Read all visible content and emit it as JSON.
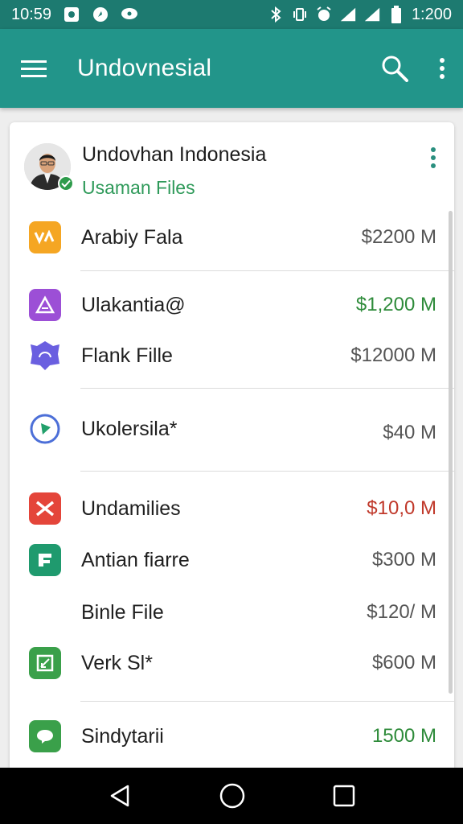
{
  "status_bar": {
    "time_left": "10:59",
    "time_right": "1:200"
  },
  "app_bar": {
    "title": "Undovnesial"
  },
  "header": {
    "name": "Undovhan Indonesia",
    "subtitle": "Usaman Files"
  },
  "rows": [
    {
      "label": "Arabiy Fala",
      "value": "$2200  M",
      "value_color": "#555555",
      "icon": "vox-app-icon",
      "icon_color": "#f5a623"
    },
    {
      "label": "Ulakantia@",
      "value": "$1,200  M",
      "value_color": "#2e8b3a",
      "icon": "triangle-app-icon",
      "icon_color": "#9c4fd6"
    },
    {
      "label": "Flank Fille",
      "value": "$12000  M",
      "value_color": "#555555",
      "icon": "badge-app-icon",
      "icon_color": "#6a5fe0"
    },
    {
      "label": "Ukolersila*",
      "value": "$40 M",
      "value_color": "#555555",
      "icon": "play-circle-icon",
      "icon_color": "#4c6fd8"
    },
    {
      "label": "Undamilies",
      "value": "$10,0  M",
      "value_color": "#c0392b",
      "icon": "x-app-icon",
      "icon_color": "#e4453a"
    },
    {
      "label": "Antian fiarre",
      "value": "$300 M",
      "value_color": "#555555",
      "icon": "f-app-icon",
      "icon_color": "#1f9a6e"
    },
    {
      "label": "Binle File",
      "value": "$120/  M",
      "value_color": "#555555",
      "icon": "none",
      "icon_color": "#ffffff"
    },
    {
      "label": "Verk Sl*",
      "value": "$600 M",
      "value_color": "#555555",
      "icon": "chart-app-icon",
      "icon_color": "#3aa04a"
    },
    {
      "label": "Sindytarii",
      "value": "1500 M",
      "value_color": "#2e8b3a",
      "icon": "chat-app-icon",
      "icon_color": "#3aa04a"
    }
  ]
}
